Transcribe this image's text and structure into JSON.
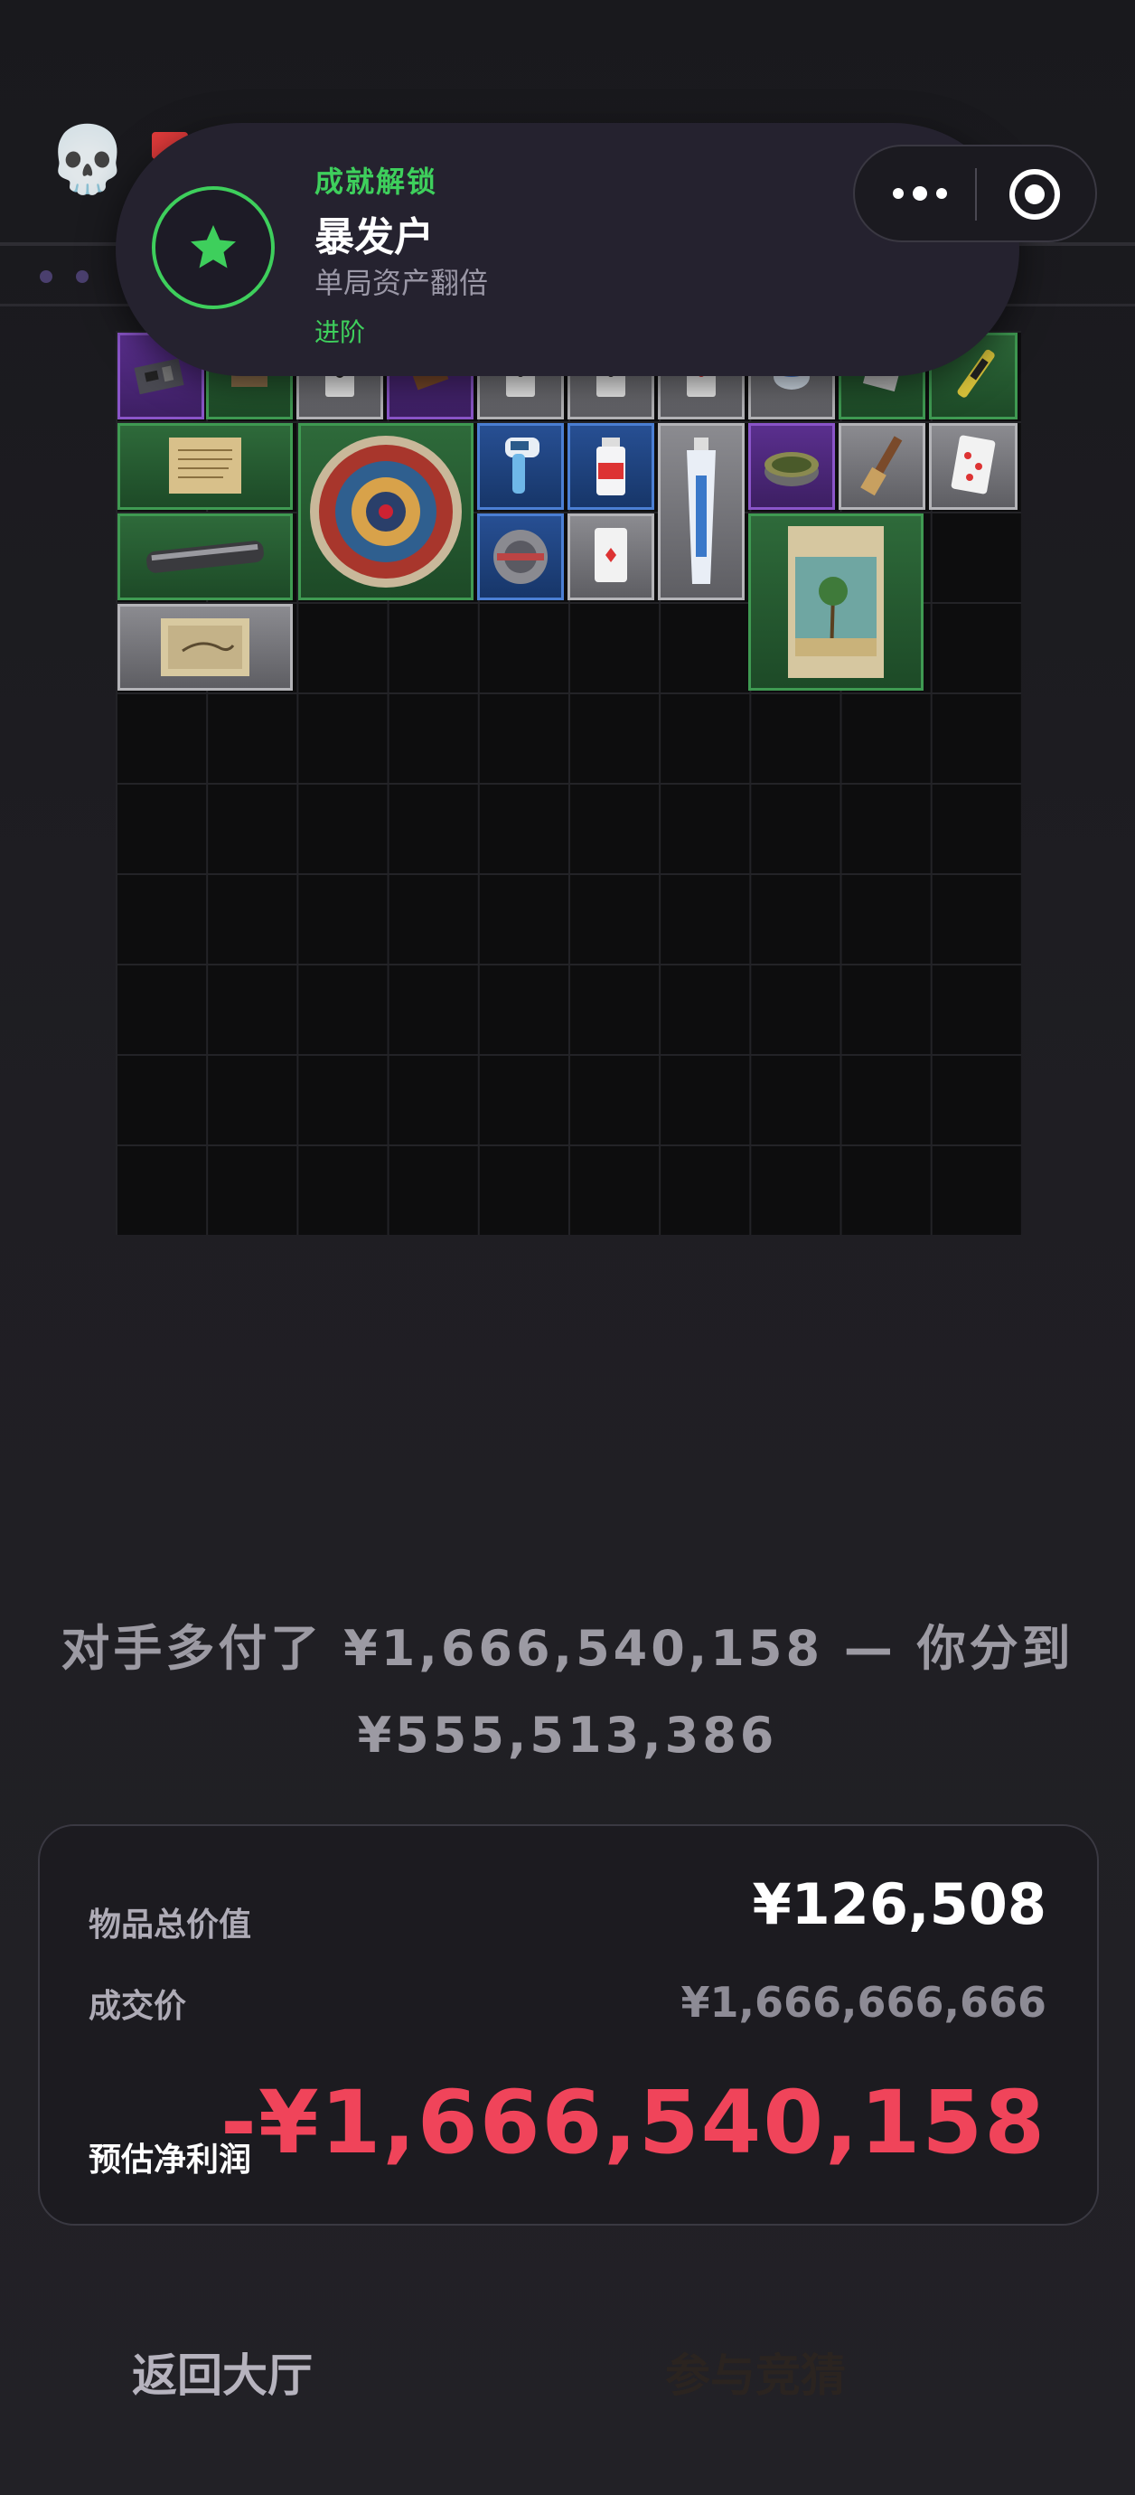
{
  "toast": {
    "kicker": "成就解锁",
    "title": "暴发户",
    "description": "单局资产翻倍",
    "tier": "进阶",
    "accent": "#3ecf5c"
  },
  "capsule": {
    "more_icon": "more-dots-icon",
    "close_icon": "target-close-icon"
  },
  "inventory": {
    "rarity_colors": {
      "green": "#3f9a52",
      "purple": "#8a55c9",
      "blue": "#4b7fd4",
      "gray": "#b4b4b8"
    }
  },
  "message": {
    "line1": "对手多付了 ¥1,666,540,158 — 你分到",
    "line2": "¥555,513,386"
  },
  "summary": {
    "total_label": "物品总价值",
    "total_value": "¥126,508",
    "deal_label": "成交价",
    "deal_value": "¥1,666,666,666",
    "profit_label": "预估净利润",
    "profit_value": "-¥1,666,540,158",
    "profit_color": "#f0445a"
  },
  "actions": {
    "back_label": "返回大厅",
    "other_label": "参与竞猜"
  }
}
